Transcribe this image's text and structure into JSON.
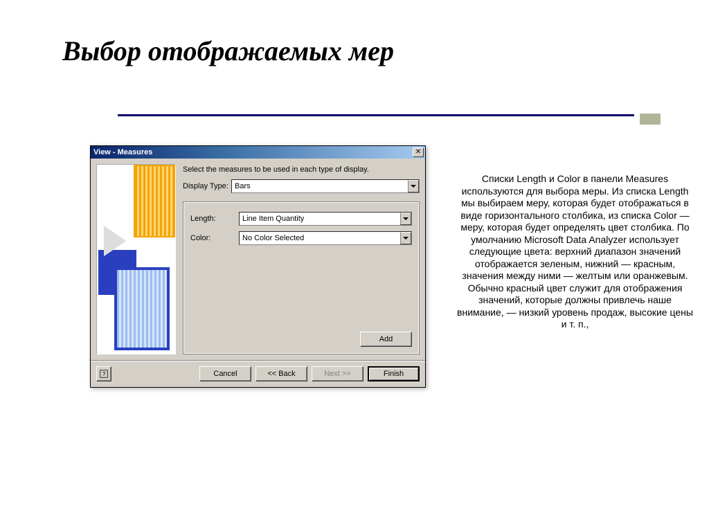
{
  "slide": {
    "title": "Выбор отображаемых мер"
  },
  "dialog": {
    "title": "View - Measures",
    "instruction": "Select the measures to be used in each type of display.",
    "labels": {
      "display_type": "Display Type:",
      "length": "Length:",
      "color": "Color:"
    },
    "values": {
      "display_type": "Bars",
      "length": "Line Item Quantity",
      "color": "No Color Selected"
    },
    "buttons": {
      "add": "Add",
      "cancel": "Cancel",
      "back": "<< Back",
      "next": "Next >>",
      "finish": "Finish"
    }
  },
  "description": {
    "text": "Списки Length и Color в панели Measures используются для выбора меры. Из списка Length мы выбираем меру, которая будет отображаться в виде горизонтального столбика, из списка Color — меру, которая будет определять цвет столбика.\nПо умолчанию Microsoft Data Analyzer использует следующие цвета: верхний диапазон значений отображается зеленым, нижний — красным, значения между ними — желтым или оранжевым. Обычно красный цвет служит для отображения значений, которые должны привлечь наше внимание, — низкий уровень продаж, высокие цены и т. п.,"
  }
}
